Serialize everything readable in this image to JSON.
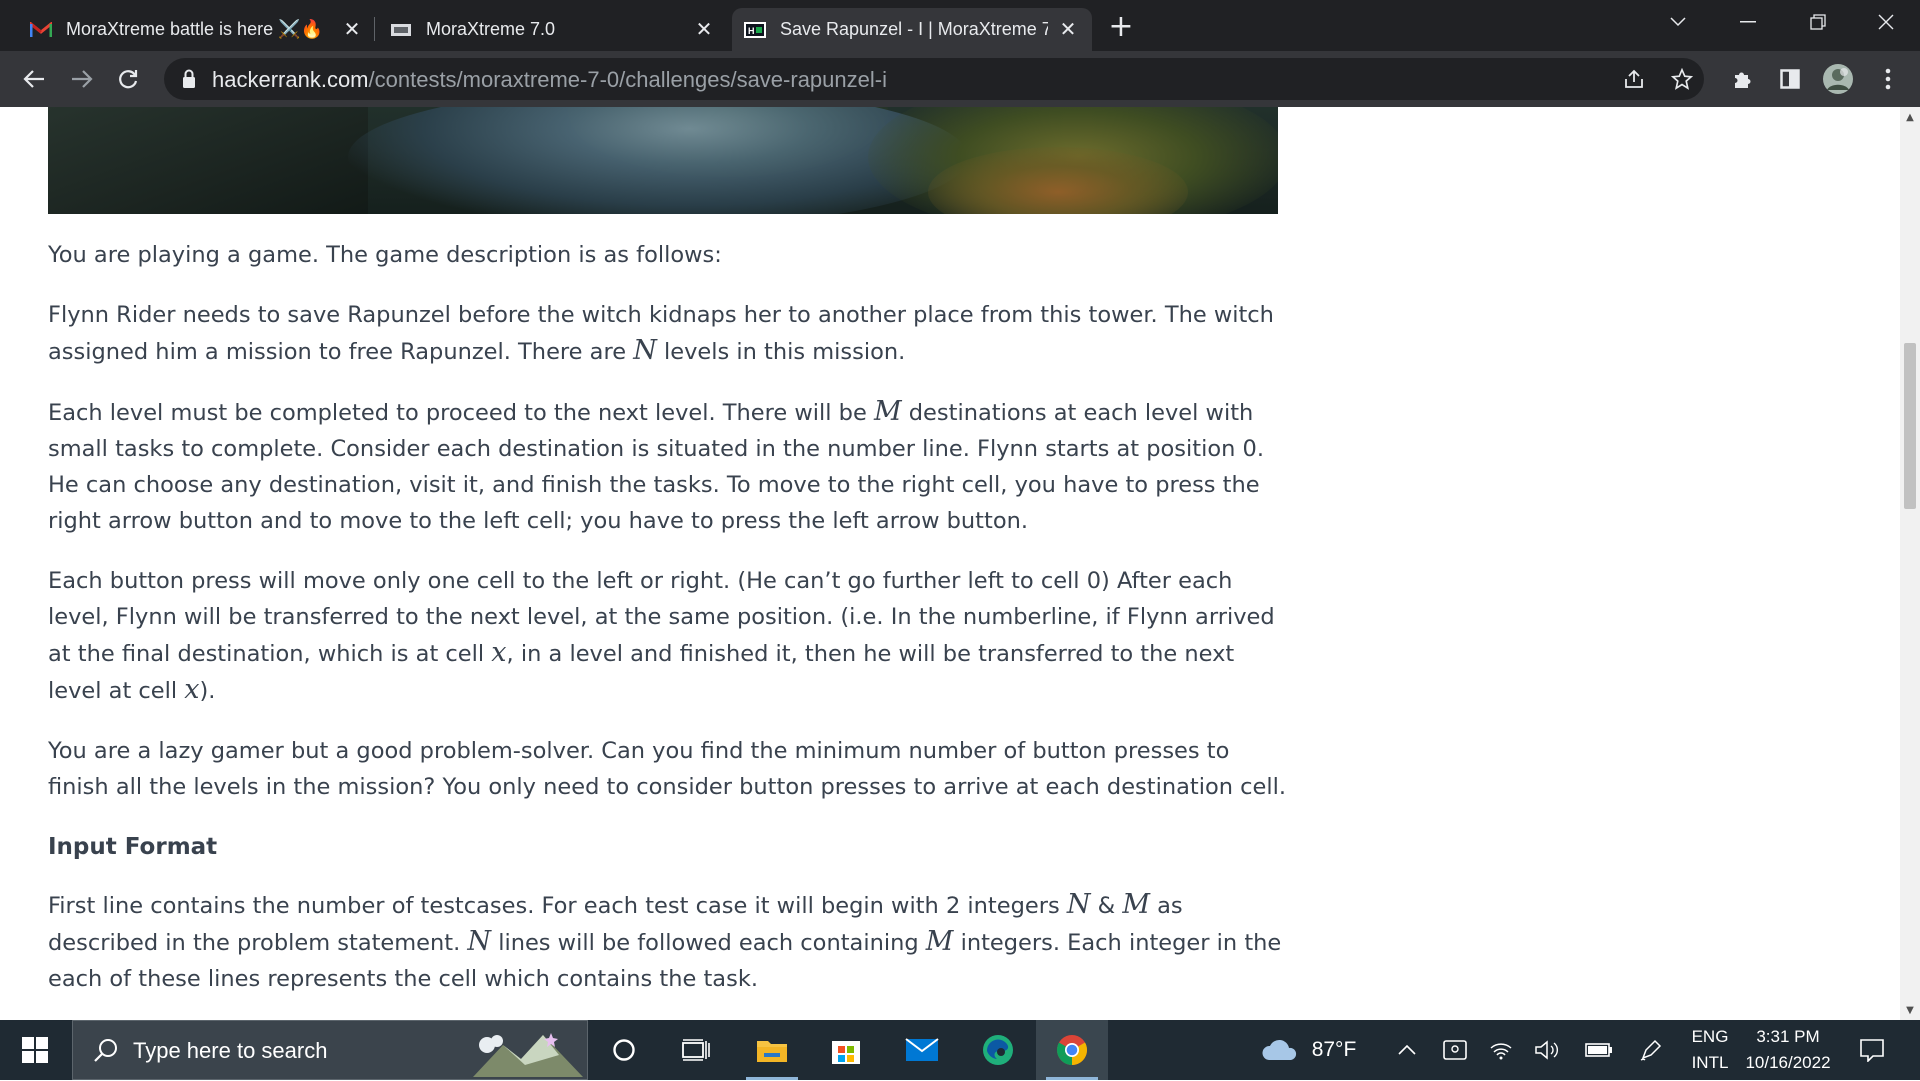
{
  "browser": {
    "tabs": [
      {
        "title": "MoraXtreme battle is here ⚔️🔥",
        "favicon": "gmail-icon",
        "active": false
      },
      {
        "title": "MoraXtreme 7.0",
        "favicon": "moraxtreme-icon",
        "active": false
      },
      {
        "title": "Save Rapunzel - I | MoraXtreme 7",
        "favicon": "hackerrank-icon",
        "active": true
      }
    ],
    "close_glyph": "✕",
    "new_tab_glyph": "+",
    "address": {
      "host": "hackerrank.com",
      "path": "/contests/moraxtreme-7-0/challenges/save-rapunzel-i"
    }
  },
  "problem": {
    "intro": "You are playing a game. The game description is as follows:",
    "p1": {
      "a": "Flynn Rider needs to save Rapunzel before the witch kidnaps her to another place from this tower. The witch assigned him a mission to free Rapunzel. There are ",
      "var": "N",
      "b": " levels in this mission."
    },
    "p2": {
      "a": "Each level must be completed to proceed to the next level. There will be ",
      "var": "M",
      "b": " destinations at each level with small tasks to complete. Consider each destination is situated in the number line. Flynn starts at position 0. He can choose any destination, visit it, and finish the tasks. To move to the right cell, you have to press the right arrow button and to move to the left cell; you have to press the left arrow button."
    },
    "p3": {
      "a": "Each button press will move only one cell to the left or right. (He can’t go further left to cell 0) After each level, Flynn will be transferred to the next level, at the same position. (i.e. In the numberline, if Flynn arrived at the final destination, which is at cell ",
      "var1": "x",
      "b": ", in a level and finished it, then he will be transferred to the next level at cell ",
      "var2": "x",
      "c": ")."
    },
    "p4": "You are a lazy gamer but a good problem-solver. Can you find the minimum number of button presses to finish all the levels in the mission? You only need to consider button presses to arrive at each destination cell.",
    "input_heading": "Input Format",
    "p5": {
      "a": "First line contains the number of testcases. For each test case it will begin with 2 integers ",
      "var1": "N",
      "amp": " & ",
      "var2": "M",
      "b": " as described in the problem statement. ",
      "var3": "N",
      "c": " lines will be followed each containing ",
      "var4": "M",
      "d": " integers. Each integer in the each of these lines represents the cell which contains the task."
    }
  },
  "taskbar": {
    "search_placeholder": "Type here to search",
    "weather": "87°F",
    "lang_top": "ENG",
    "lang_bottom": "INTL",
    "time": "3:31 PM",
    "date": "10/16/2022"
  },
  "colors": {
    "chrome_dark": "#202124",
    "chrome_toolbar": "#35363a",
    "text": "#39424e",
    "taskbar": "#1f2a33"
  }
}
